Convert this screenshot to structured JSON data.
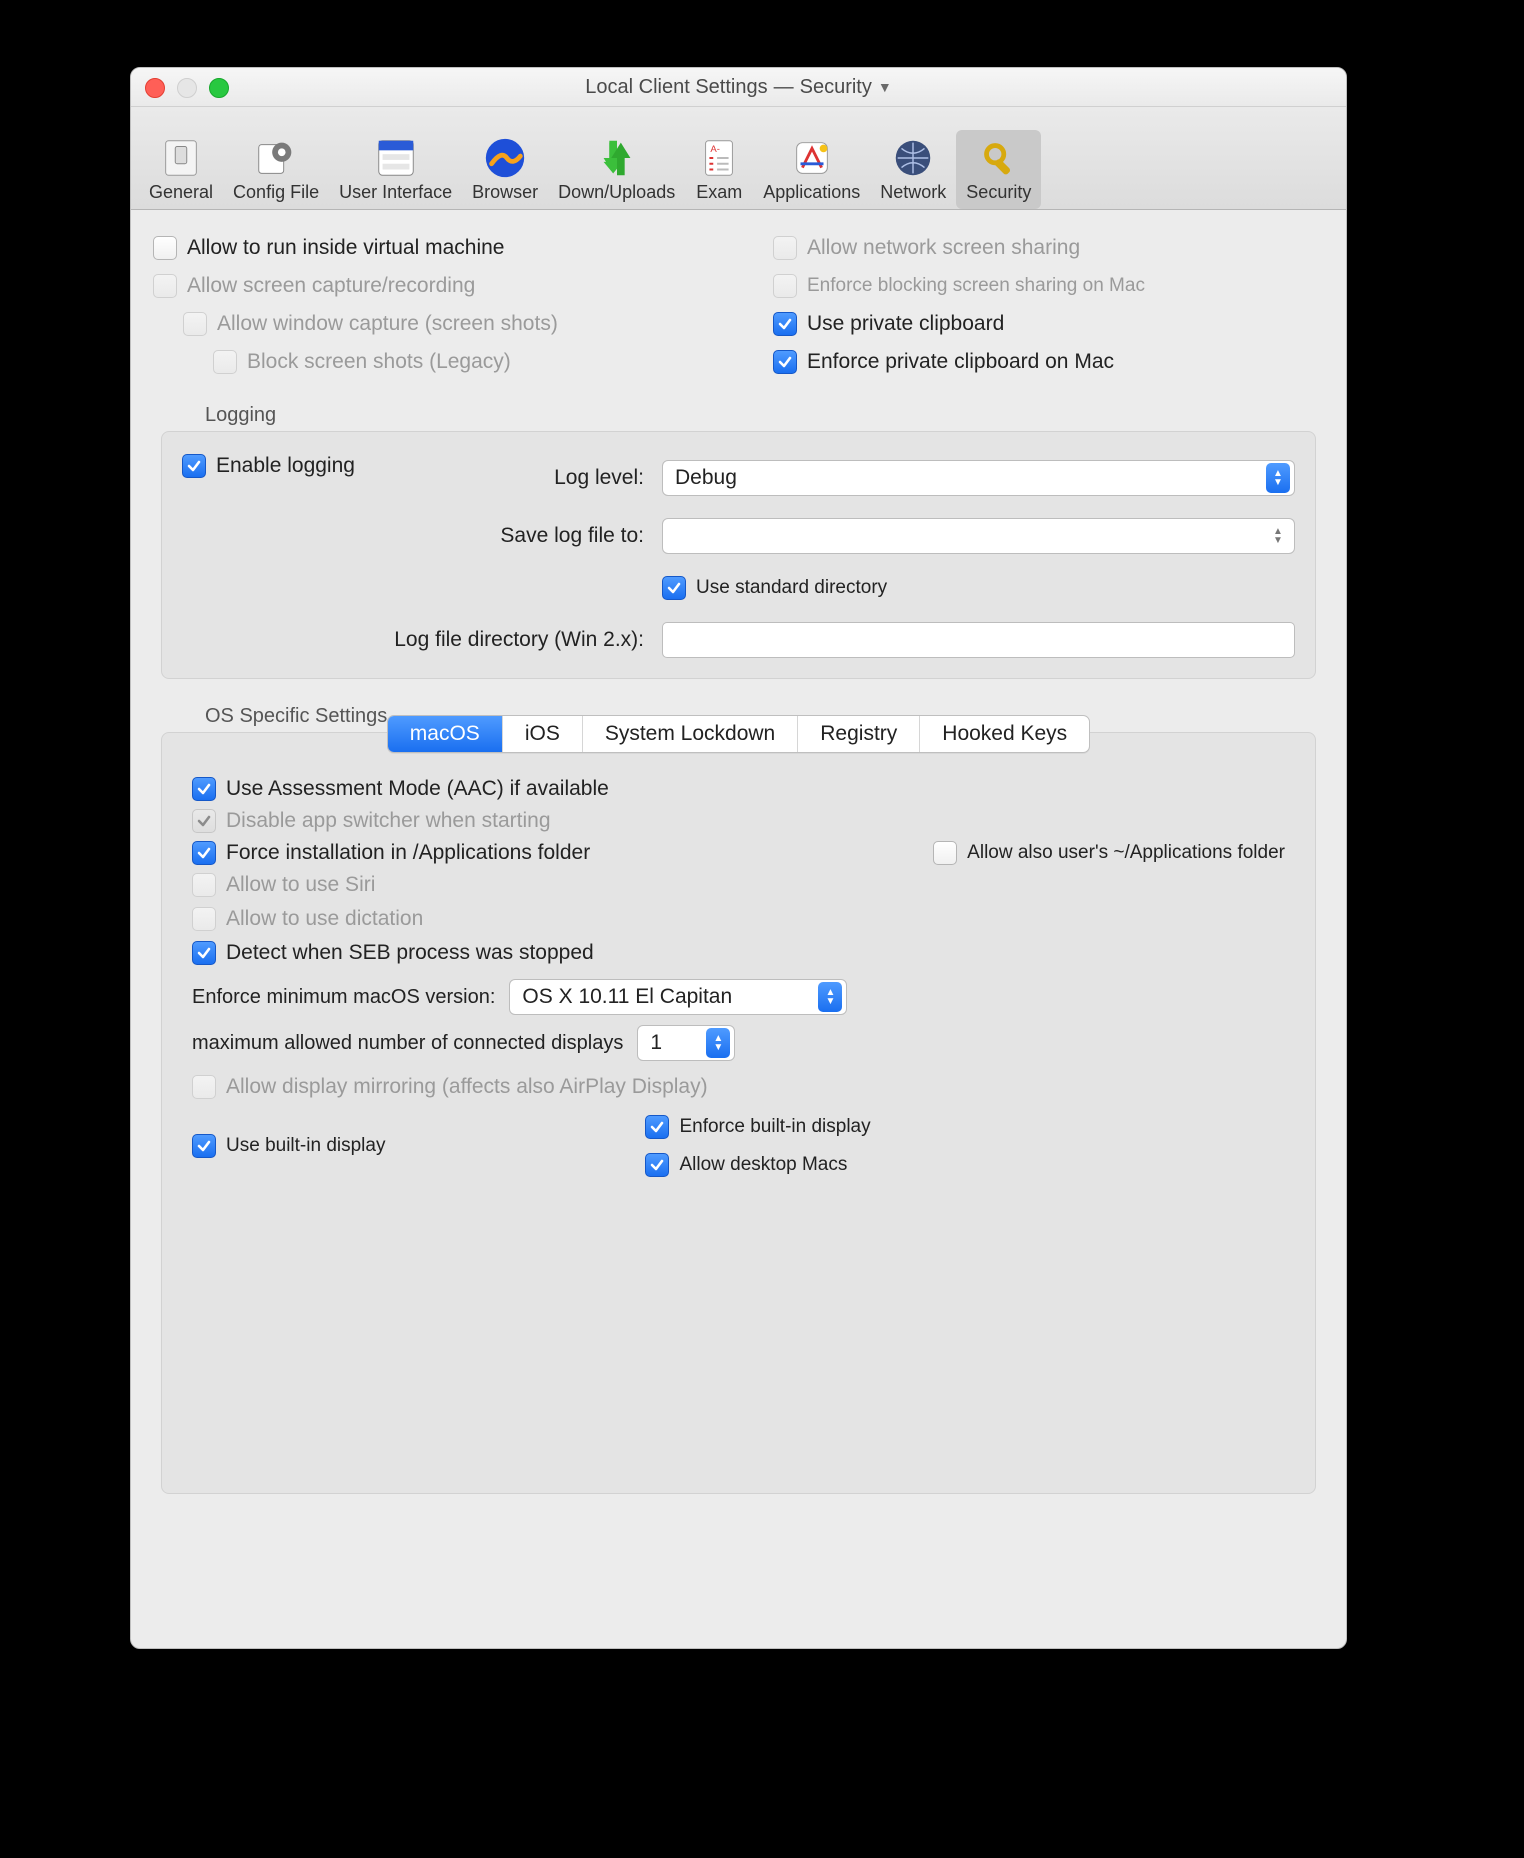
{
  "window": {
    "title_left": "Local Client Settings",
    "title_sep": "—",
    "title_right": "Security"
  },
  "toolbar": {
    "items": [
      {
        "label": "General"
      },
      {
        "label": "Config File"
      },
      {
        "label": "User Interface"
      },
      {
        "label": "Browser"
      },
      {
        "label": "Down/Uploads"
      },
      {
        "label": "Exam"
      },
      {
        "label": "Applications"
      },
      {
        "label": "Network"
      },
      {
        "label": "Security"
      }
    ],
    "selected_index": 8
  },
  "top_left": {
    "allow_vm": "Allow to run inside virtual machine",
    "allow_capture": "Allow screen capture/recording",
    "allow_window_capture": "Allow window capture (screen shots)",
    "block_screenshots": "Block screen shots (Legacy)"
  },
  "top_right": {
    "allow_network_share": "Allow network screen sharing",
    "enforce_block_share": "Enforce blocking screen sharing on Mac",
    "use_private_clip": "Use private clipboard",
    "enforce_private_clip": "Enforce private clipboard on Mac"
  },
  "logging": {
    "group_title": "Logging",
    "enable": "Enable logging",
    "log_level_label": "Log level:",
    "log_level_value": "Debug",
    "save_to_label": "Save log file to:",
    "save_to_value": "",
    "use_std_dir": "Use standard directory",
    "win_dir_label": "Log file directory (Win 2.x):",
    "win_dir_value": ""
  },
  "os": {
    "group_title": "OS Specific Settings",
    "tabs": [
      "macOS",
      "iOS",
      "System Lockdown",
      "Registry",
      "Hooked Keys"
    ],
    "active_tab": 0,
    "use_aac": "Use Assessment Mode (AAC) if available",
    "disable_switcher": "Disable app switcher when starting",
    "force_install": "Force installation in /Applications folder",
    "allow_user_apps": "Allow also user's ~/Applications folder",
    "allow_siri": "Allow to use Siri",
    "allow_dictation": "Allow to use dictation",
    "detect_stopped": "Detect when SEB process was stopped",
    "min_macos_label": "Enforce minimum macOS version:",
    "min_macos_value": "OS X 10.11 El Capitan",
    "max_displays_label": "maximum allowed number of connected displays",
    "max_displays_value": "1",
    "allow_mirror": "Allow display mirroring (affects also AirPlay Display)",
    "use_builtin": "Use built-in display",
    "enforce_builtin": "Enforce built-in display",
    "allow_desktop_macs": "Allow desktop Macs"
  }
}
